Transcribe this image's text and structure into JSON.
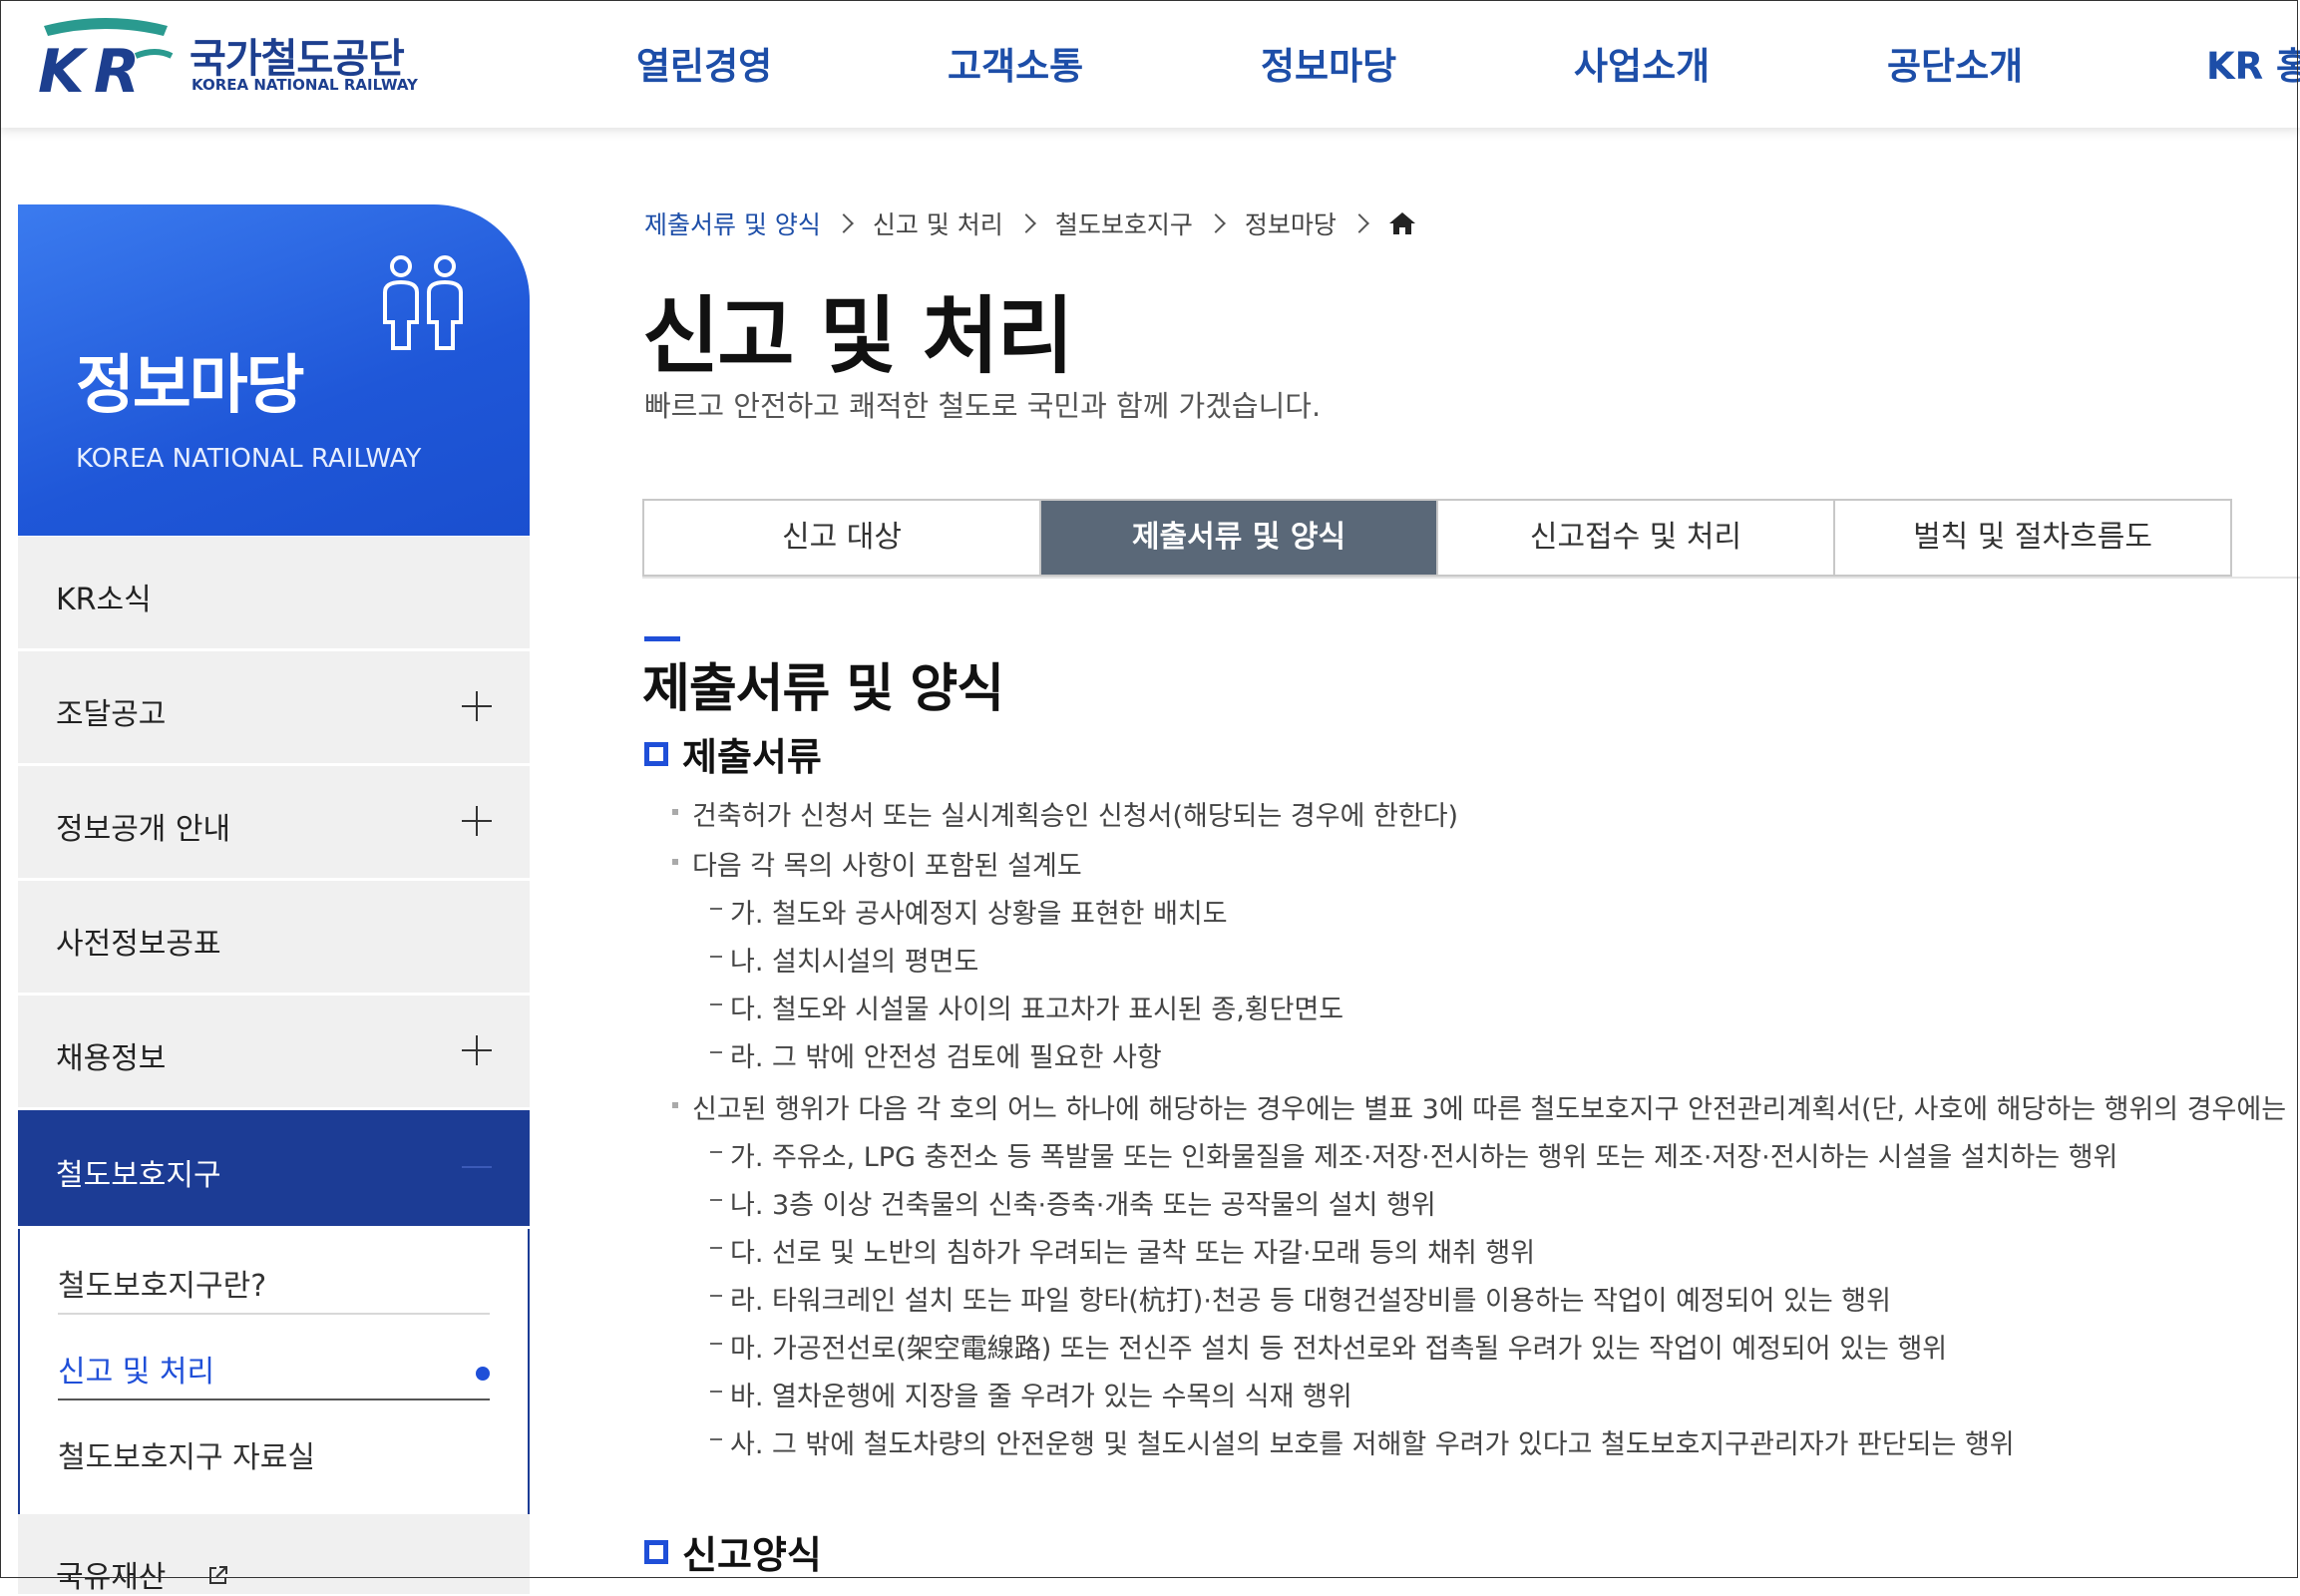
{
  "header": {
    "logo_ko": "국가철도공단",
    "logo_en": "KOREA NATIONAL RAILWAY",
    "nav": [
      "열린경영",
      "고객소통",
      "정보마당",
      "사업소개",
      "공단소개",
      "KR 홍"
    ]
  },
  "sidebar": {
    "title": "정보마당",
    "subtitle": "KOREA NATIONAL RAILWAY",
    "items": [
      {
        "label": "KR소식"
      },
      {
        "label": "조달공고"
      },
      {
        "label": "정보공개 안내"
      },
      {
        "label": "사전정보공표"
      },
      {
        "label": "채용정보"
      },
      {
        "label": "철도보호지구"
      }
    ],
    "sub_items": [
      {
        "label": "철도보호지구란?"
      },
      {
        "label": "신고 및 처리"
      },
      {
        "label": "철도보호지구 자료실"
      }
    ],
    "last_item": "국유재산"
  },
  "breadcrumb": [
    "제출서류 및 양식",
    "신고 및 처리",
    "철도보호지구",
    "정보마당"
  ],
  "page": {
    "title": "신고 및 처리",
    "description": "빠르고 안전하고 쾌적한 철도로 국민과 함께 가겠습니다."
  },
  "tabs": [
    "신고 대상",
    "제출서류 및 양식",
    "신고접수 및 처리",
    "벌칙 및 절차흐름도"
  ],
  "content": {
    "section_title": "제출서류 및 양식",
    "documents_heading": "제출서류",
    "lines": [
      "건축허가 신청서 또는 실시계획승인 신청서(해당되는 경우에 한한다)",
      "다음 각 목의 사항이 포함된 설계도",
      "가. 철도와 공사예정지 상황을 표현한 배치도",
      "나. 설치시설의 평면도",
      "다. 철도와 시설물 사이의 표고차가 표시된 종,횡단면도",
      "라. 그 밖에 안전성 검토에 필요한 사항",
      "신고된 행위가 다음 각 호의 어느 하나에 해당하는 경우에는 별표 3에 따른 철도보호지구 안전관리계획서(단, 사호에 해당하는 행위의 경우에는",
      "가. 주유소, LPG 충전소 등 폭발물 또는 인화물질을 제조·저장·전시하는 행위 또는 제조·저장·전시하는 시설을 설치하는 행위",
      "나. 3층 이상 건축물의 신축·증축·개축 또는 공작물의 설치 행위",
      "다. 선로 및 노반의 침하가 우려되는 굴착 또는 자갈·모래 등의 채취 행위",
      "라. 타워크레인 설치 또는 파일 항타(杭打)·천공 등 대형건설장비를 이용하는 작업이 예정되어 있는 행위",
      "마. 가공전선로(架空電線路) 또는 전신주 설치 등 전차선로와 접촉될 우려가 있는 작업이 예정되어 있는 행위",
      "바. 열차운행에 지장을 줄 우려가 있는 수목의 식재 행위",
      "사. 그 밖에 철도차량의 안전운행 및 철도시설의 보호를 저해할 우려가 있다고 철도보호지구관리자가 판단되는 행위"
    ],
    "forms_heading": "신고양식"
  },
  "colors": {
    "brand_blue": "#1d4ea8",
    "sidebar_active": "#1c3c95",
    "tab_active": "#5a6878",
    "accent": "#1f4fd8"
  }
}
